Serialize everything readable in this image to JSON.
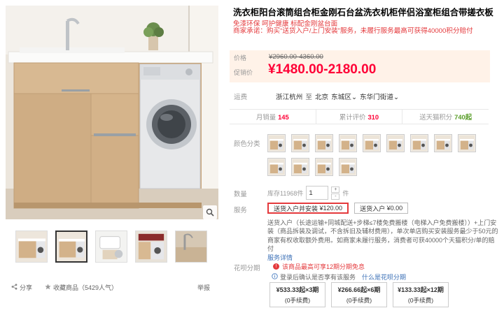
{
  "product": {
    "title": "洗衣柜阳台滚筒组合柜金刚石台盆洗衣机柜伴侣浴室柜组合带搓衣板",
    "subtitle": "免漆环保 呵护健康 标配金刚盆台面",
    "promise": "商家承诺：购买“送货入户/上门安装”服务，未履行服务最高可获得40000积分赔付"
  },
  "price": {
    "orig_label": "价格",
    "orig_value": "¥2960.00-4360.00",
    "sale_label": "促销价",
    "sale_value": "¥1480.00-2180.00"
  },
  "shipping": {
    "label": "运费",
    "from": "浙江杭州",
    "to_label": "至",
    "city": "北京",
    "district": "东城区",
    "street": "东华门街道"
  },
  "stats": [
    {
      "label": "月销量",
      "value": "145",
      "color": "red"
    },
    {
      "label": "累计评价",
      "value": "310",
      "color": "red"
    },
    {
      "label": "送天猫积分",
      "value": "740起",
      "color": "green"
    }
  ],
  "color": {
    "label": "颜色分类",
    "swatch_count": 13
  },
  "quantity": {
    "label": "数量",
    "stock": "库存11968件",
    "value": "1",
    "unit": "件",
    "plus": "+",
    "minus": "-"
  },
  "service": {
    "label": "服务",
    "options": [
      {
        "name": "送货入户并安装",
        "price": "¥120.00",
        "selected": true
      },
      {
        "name": "送货入户",
        "price": "¥0.00",
        "selected": false
      }
    ],
    "description": "送货入户（长途运输+同城配送+步梯≤7楼免费搬楼（电梯入户免费搬楼））+上门安装（商品拆装及调试，不含拆旧及辅材费用），单次单店购买安装服务最少于50元的商家有权收取额外费用。如商家未履行服务，消费者可获40000个天猫积分/单的赔付",
    "details_link": "服务详情"
  },
  "huabei": {
    "label": "花呗分期",
    "tip": "该商品最高可享12期分期免息",
    "login_text": "登录后确认是否享有该服务",
    "what_link": "什么是花呗分期",
    "plans": [
      {
        "amount": "¥533.33起×3期",
        "fee": "(0手续费)"
      },
      {
        "amount": "¥266.66起×6期",
        "fee": "(0手续费)"
      },
      {
        "amount": "¥133.33起×12期",
        "fee": "(0手续费)"
      }
    ]
  },
  "actions": {
    "share": "分享",
    "favorite": "收藏商品（5429人气）",
    "report": "举报"
  },
  "gallery": {
    "thumb_count": 5
  }
}
